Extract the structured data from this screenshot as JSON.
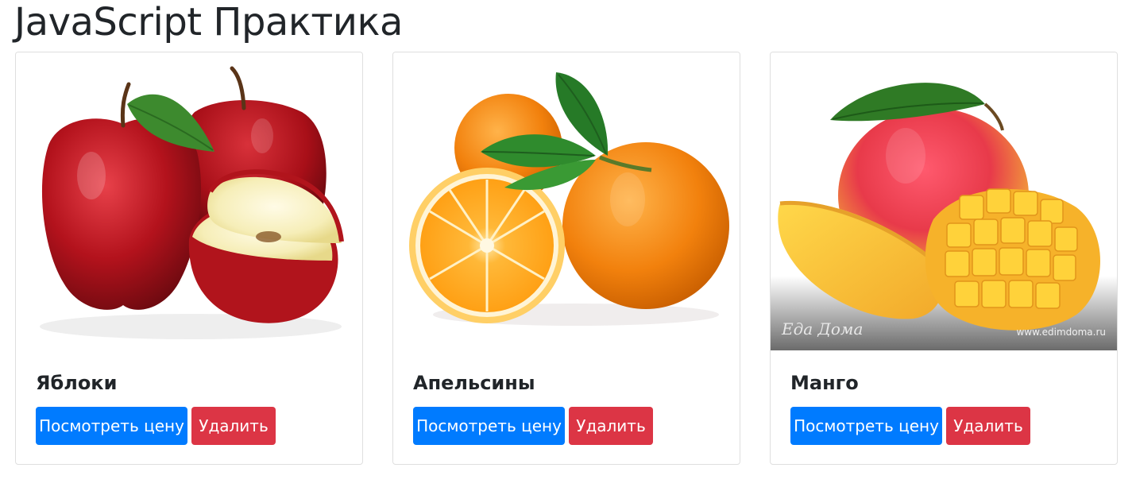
{
  "page": {
    "title": "JavaScript Практика"
  },
  "cards": [
    {
      "name": "Яблоки",
      "image": "red-apples-image",
      "price_button": "Посмотреть цену",
      "delete_button": "Удалить"
    },
    {
      "name": "Апельсины",
      "image": "oranges-image",
      "price_button": "Посмотреть цену",
      "delete_button": "Удалить"
    },
    {
      "name": "Манго",
      "image": "mango-image",
      "price_button": "Посмотреть цену",
      "delete_button": "Удалить",
      "watermark": {
        "logo": "Еда Дома",
        "url": "www.edimdoma.ru"
      }
    }
  ],
  "colors": {
    "primary": "#007bff",
    "danger": "#dc3545",
    "text": "#212529",
    "border": "rgba(0,0,0,0.125)"
  }
}
